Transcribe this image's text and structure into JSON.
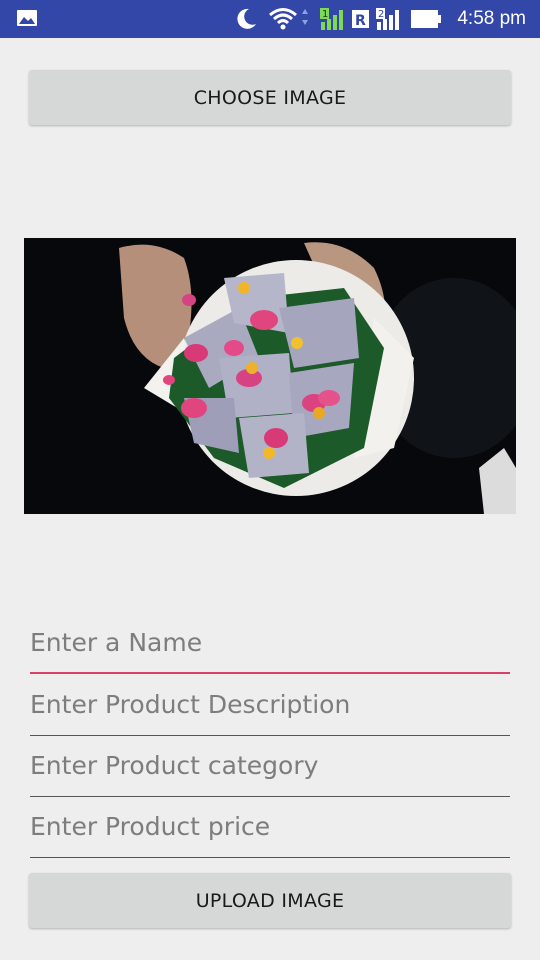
{
  "status_bar": {
    "time": "4:58 pm",
    "sim1_label": "1",
    "sim2_label": "2",
    "roaming_label": "R",
    "icons": [
      "gallery-icon",
      "moon-icon",
      "wifi-icon",
      "signal-icon",
      "battery-icon"
    ],
    "background_color": "#3247a8"
  },
  "choose_button": {
    "label": "CHOOSE IMAGE"
  },
  "preview": {
    "description_icon": "photo-preview"
  },
  "form": {
    "name_placeholder": "Enter a Name",
    "description_placeholder": "Enter Product Description",
    "category_placeholder": "Enter Product category",
    "price_placeholder": "Enter Product price",
    "focused_field": "name",
    "accent_color": "#d83f6a"
  },
  "upload_button": {
    "label": "UPLOAD IMAGE"
  }
}
